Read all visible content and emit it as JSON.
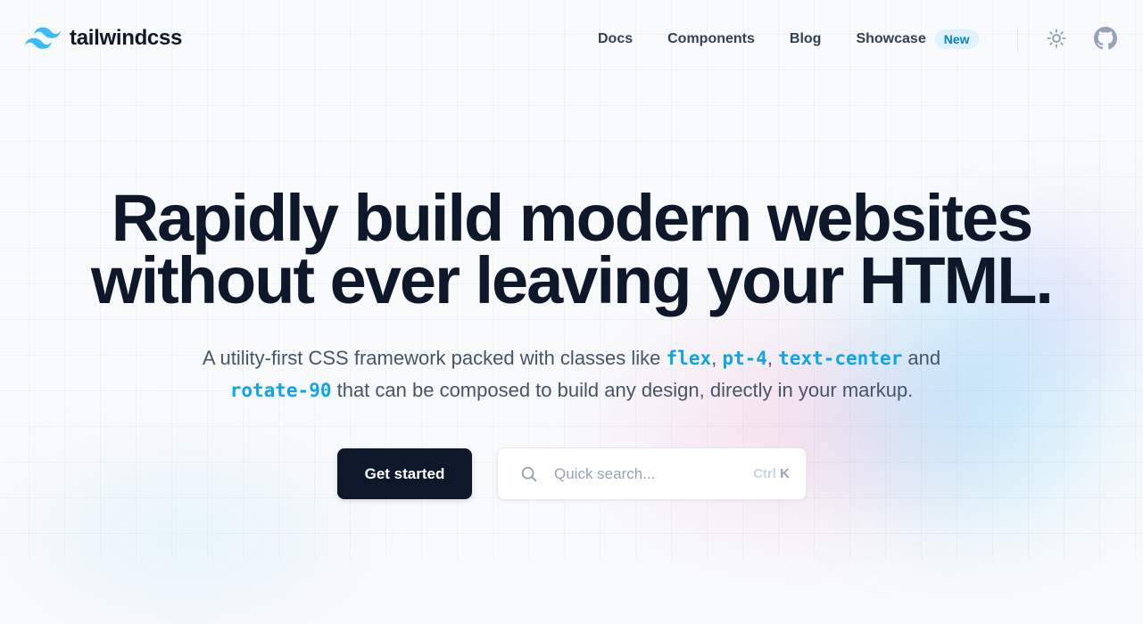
{
  "brand": {
    "name": "tailwindcss",
    "accent": "#38bdf8"
  },
  "nav": {
    "links": [
      {
        "label": "Docs"
      },
      {
        "label": "Components"
      },
      {
        "label": "Blog"
      },
      {
        "label": "Showcase"
      }
    ],
    "showcase_badge": "New",
    "theme_toggle_icon": "sun-icon",
    "github_icon": "github-icon"
  },
  "hero": {
    "title_line1": "Rapidly build modern websites",
    "title_line2": "without ever leaving your HTML.",
    "subtitle": {
      "part1": "A utility-first CSS framework packed with classes like ",
      "code1": "flex",
      "sep1": ", ",
      "code2": "pt-4",
      "sep2": ", ",
      "code3": "text-center",
      "part2": " and ",
      "code4": "rotate-90",
      "part3": " that can be composed to build any design, directly in your markup."
    },
    "cta_label": "Get started",
    "search": {
      "placeholder": "Quick search...",
      "shortcut_modifier": "Ctrl",
      "shortcut_key": "K"
    }
  },
  "colors": {
    "text_primary": "#0f172a",
    "text_secondary": "#475569",
    "code_accent": "#0ea5e9",
    "badge_bg": "#e0f2fe",
    "badge_text": "#0284c7"
  }
}
